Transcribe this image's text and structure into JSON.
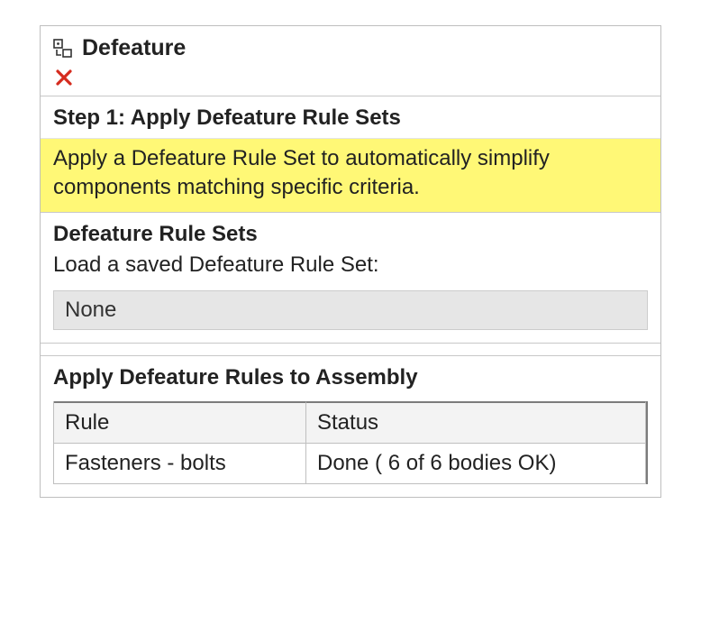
{
  "header": {
    "title": "Defeature"
  },
  "step": {
    "heading": "Step 1: Apply Defeature Rule Sets",
    "description": "Apply a Defeature Rule Set to automatically simplify components matching specific criteria."
  },
  "ruleSets": {
    "heading": "Defeature Rule Sets",
    "loadLabel": "Load a saved Defeature Rule Set:",
    "selected": "None"
  },
  "applySection": {
    "heading": "Apply Defeature Rules to Assembly",
    "columns": {
      "rule": "Rule",
      "status": "Status"
    },
    "rows": [
      {
        "rule": "Fasteners - bolts",
        "status": "Done ( 6 of  6 bodies OK)"
      }
    ]
  }
}
